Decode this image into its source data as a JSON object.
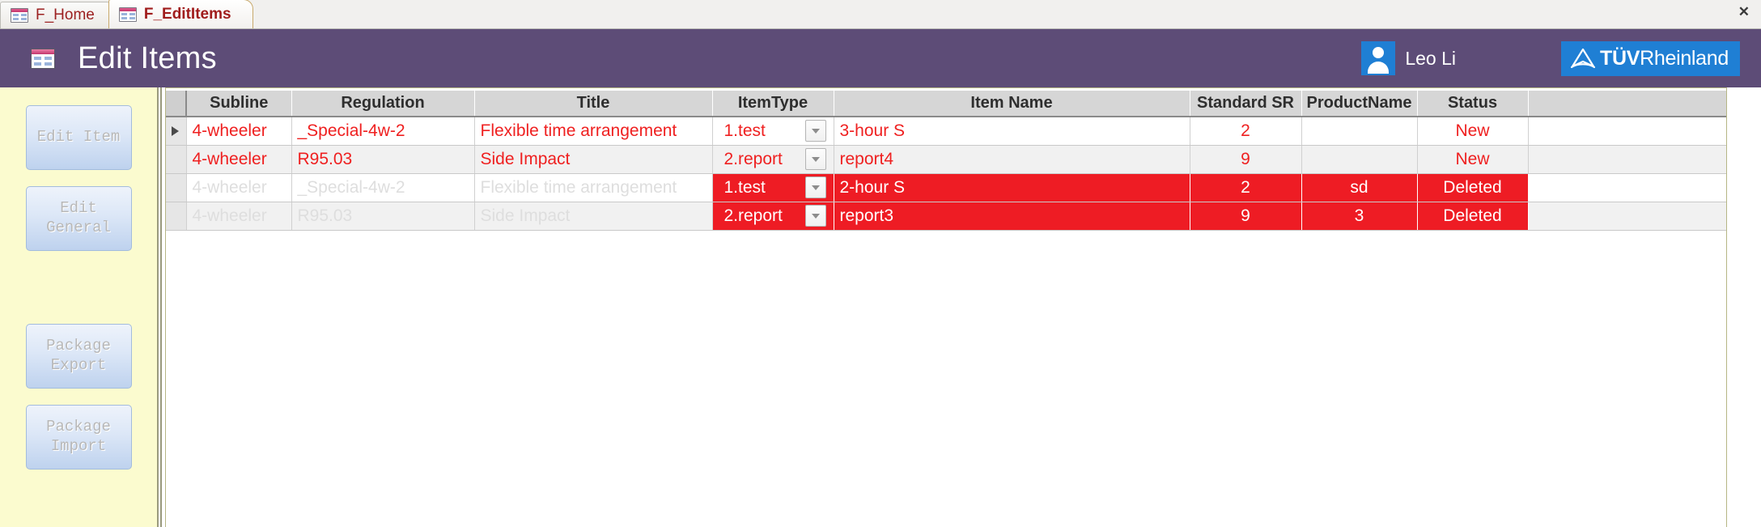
{
  "window": {
    "close_label": "✕"
  },
  "tabs": [
    {
      "label": "F_Home",
      "icon": "form-icon",
      "active": false
    },
    {
      "label": "F_EditItems",
      "icon": "form-icon",
      "active": true
    }
  ],
  "header": {
    "icon": "form-icon",
    "title": "Edit Items",
    "user": {
      "name": "Leo Li",
      "avatar_icon": "user-avatar-icon"
    },
    "logo": {
      "bold_text": "TÜV",
      "light_text": "Rheinland",
      "mark_icon": "tuv-triangle-icon",
      "color": "#1f7fd4"
    }
  },
  "sidebar": {
    "buttons": [
      {
        "label": "Edit Item",
        "enabled": false
      },
      {
        "label": "Edit\nGeneral",
        "enabled": false
      },
      {
        "label": "Package\nExport",
        "enabled": false
      },
      {
        "label": "Package\nImport",
        "enabled": false
      }
    ]
  },
  "grid": {
    "columns": [
      "Subline",
      "Regulation",
      "Title",
      "ItemType",
      "Item Name",
      "Standard SR",
      "ProductName",
      "Status"
    ],
    "dropdown_icon": "chevron-down-icon",
    "selector_icon": "record-selector-arrow",
    "rows": [
      {
        "selected": true,
        "deleted": false,
        "subline": "4-wheeler",
        "regulation": "_Special-4w-2",
        "title": "Flexible time arrangement",
        "item_type": "1.test",
        "item_name": "3-hour S",
        "standard_sr": "2",
        "product_name": "",
        "status": "New"
      },
      {
        "selected": false,
        "deleted": false,
        "subline": "4-wheeler",
        "regulation": "R95.03",
        "title": "Side Impact",
        "item_type": "2.report",
        "item_name": "report4",
        "standard_sr": "9",
        "product_name": "",
        "status": "New"
      },
      {
        "selected": false,
        "deleted": true,
        "subline": "4-wheeler",
        "regulation": "_Special-4w-2",
        "title": "Flexible time arrangement",
        "item_type": "1.test",
        "item_name": "2-hour S",
        "standard_sr": "2",
        "product_name": "sd",
        "status": "Deleted"
      },
      {
        "selected": false,
        "deleted": true,
        "subline": "4-wheeler",
        "regulation": "R95.03",
        "title": "Side Impact",
        "item_type": "2.report",
        "item_name": "report3",
        "standard_sr": "9",
        "product_name": "3",
        "status": "Deleted"
      }
    ]
  },
  "colors": {
    "header_bg": "#5d4c77",
    "sidebar_bg": "#fbfbcf",
    "deleted_bg": "#ee1c24",
    "data_text": "#ef2020",
    "brand_blue": "#1f7fd4"
  }
}
